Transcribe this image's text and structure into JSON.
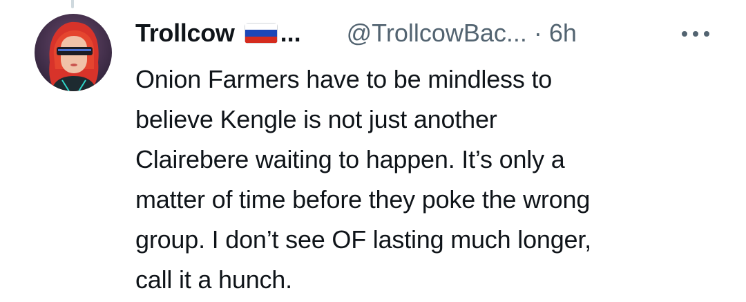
{
  "author": {
    "display_name": "Trollcow",
    "name_truncation": "...",
    "flag_icon": "russia-flag-icon",
    "handle": "@TrollcowBac...",
    "separator": "·",
    "time": "6h"
  },
  "tweet": {
    "lines": [
      "Onion Farmers have to be mindless to",
      "believe Kengle is not just another",
      "Clairebere waiting to happen. It’s only a",
      "matter of time before they poke the wrong",
      "group. I don’t see OF lasting much longer,",
      "call it a hunch."
    ]
  },
  "icons": {
    "more": "more-dots-icon",
    "avatar": "avatar-image"
  },
  "colors": {
    "text_primary": "#0f1419",
    "text_secondary": "#536471",
    "thread_line": "#cfd9de"
  }
}
